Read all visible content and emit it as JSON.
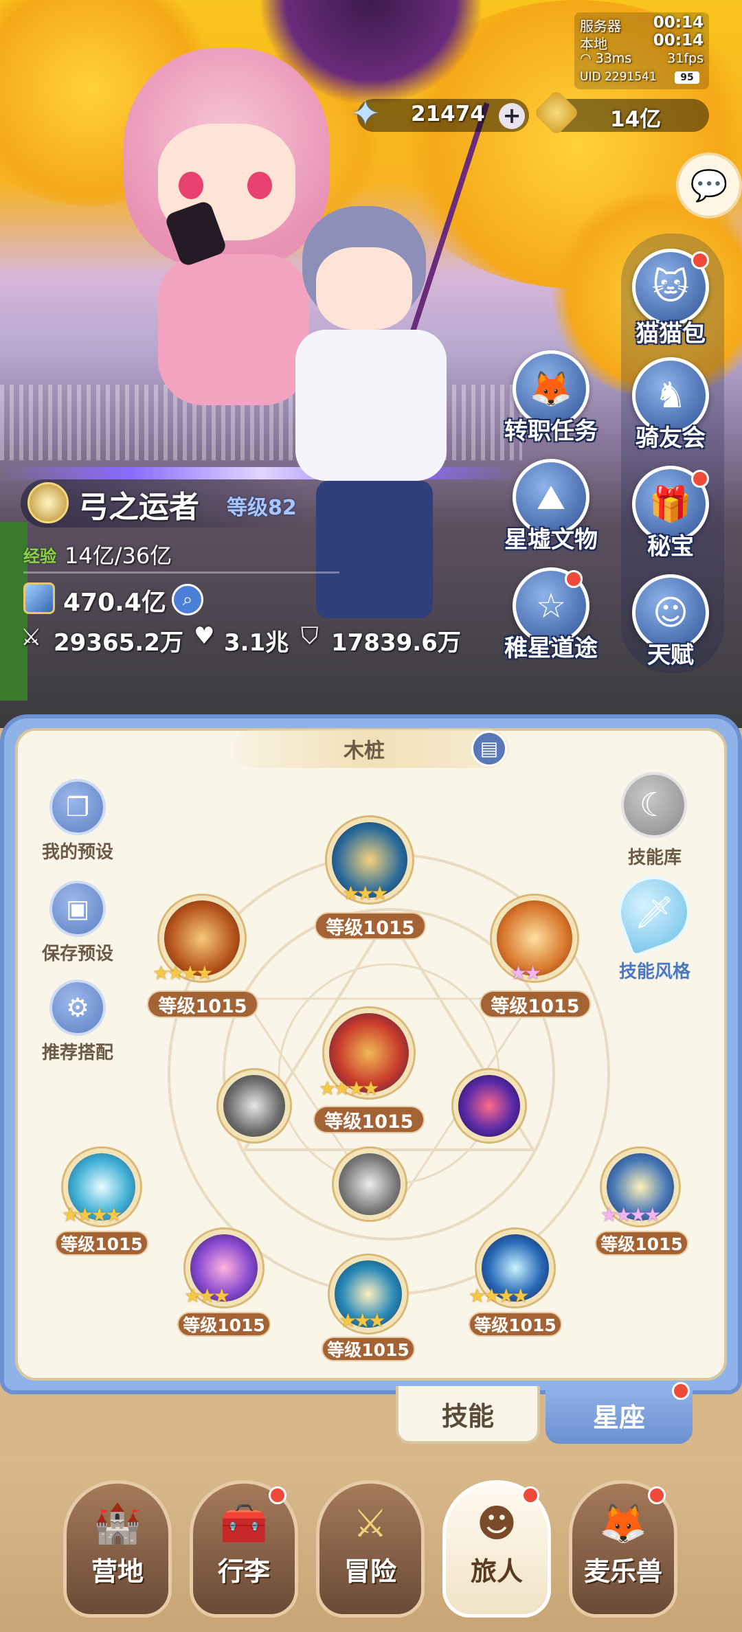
{
  "status": {
    "server_label": "服务器",
    "server_time": "00:14",
    "local_label": "本地",
    "local_time": "00:14",
    "ping": "33ms",
    "fps": "31fps",
    "uid": "UID 2291541",
    "battery": "95"
  },
  "currency": {
    "stars": "21474",
    "gold": "14亿"
  },
  "menu": {
    "cat_bag": "猫猫包",
    "job_task": "转职任务",
    "rider_club": "骑友会",
    "relics": "星墟文物",
    "secret_treasure": "秘宝",
    "star_path": "稚星道途",
    "talent": "天赋"
  },
  "player": {
    "name": "弓之运者",
    "level": "等级82",
    "exp_label": "经验",
    "exp_value": "14亿/36亿",
    "power": "470.4亿",
    "attack": "29365.2万",
    "hp": "3.1兆",
    "defense": "17839.6万"
  },
  "skills": {
    "target": "木桩",
    "preset_mine": "我的预设",
    "preset_save": "保存预设",
    "preset_recommend": "推荐搭配",
    "library": "技能库",
    "style": "技能风格",
    "levels": {
      "top": "等级1015",
      "upper_left": "等级1015",
      "upper_right": "等级1015",
      "center": "等级1015",
      "left": "等级1015",
      "right": "等级1015",
      "bottom_left": "等级1015",
      "bottom_center": "等级1015",
      "bottom_right": "等级1015"
    }
  },
  "tabs": {
    "skill": "技能",
    "constellation": "星座"
  },
  "nav": {
    "camp": "营地",
    "luggage": "行李",
    "adventure": "冒险",
    "traveler": "旅人",
    "beast": "麦乐兽"
  }
}
